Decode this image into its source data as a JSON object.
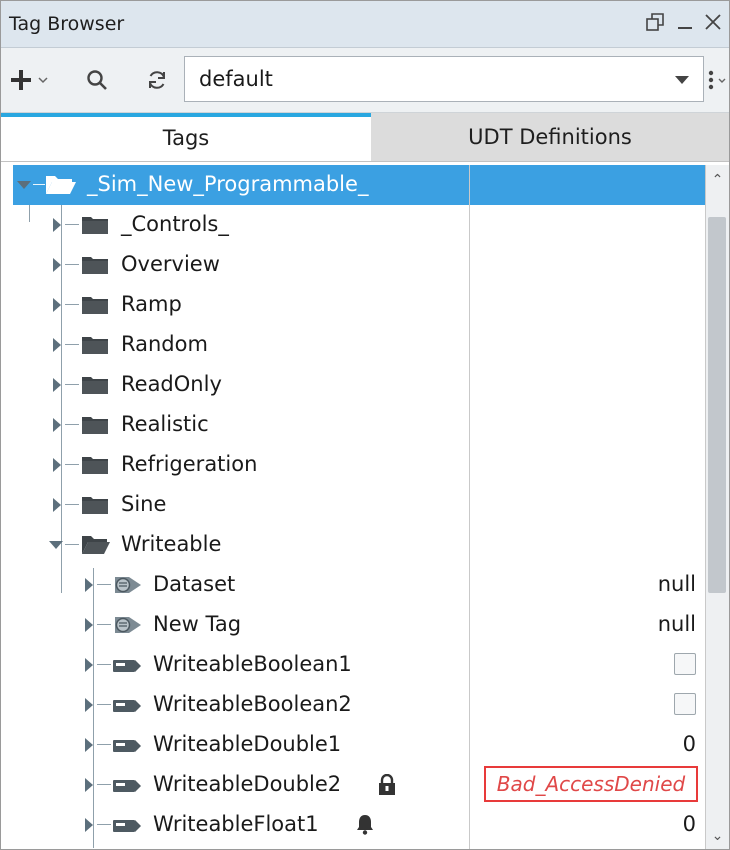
{
  "window": {
    "title": "Tag Browser"
  },
  "toolbar": {
    "provider_value": "default"
  },
  "tabs": [
    {
      "label": "Tags"
    },
    {
      "label": "UDT Definitions"
    }
  ],
  "tree": {
    "root": {
      "label": "_Sim_New_Programmable_"
    },
    "folders": [
      {
        "label": "_Controls_"
      },
      {
        "label": "Overview"
      },
      {
        "label": "Ramp"
      },
      {
        "label": "Random"
      },
      {
        "label": "ReadOnly"
      },
      {
        "label": "Realistic"
      },
      {
        "label": "Refrigeration"
      },
      {
        "label": "Sine"
      },
      {
        "label": "Writeable"
      }
    ],
    "tags": [
      {
        "label": "Dataset",
        "value": "null"
      },
      {
        "label": "New Tag",
        "value": "null"
      },
      {
        "label": "WriteableBoolean1",
        "value": ""
      },
      {
        "label": "WriteableBoolean2",
        "value": ""
      },
      {
        "label": "WriteableDouble1",
        "value": "0"
      },
      {
        "label": "WriteableDouble2",
        "value": "Bad_AccessDenied"
      },
      {
        "label": "WriteableFloat1",
        "value": "0"
      }
    ]
  },
  "colors": {
    "selection": "#3ba0e2",
    "tab_accent": "#29a7e0",
    "error": "#e04848"
  }
}
